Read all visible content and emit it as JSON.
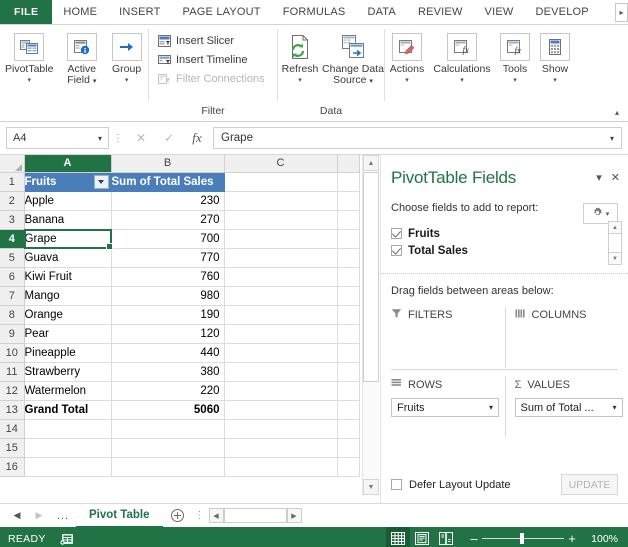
{
  "ribbon": {
    "tabs": [
      {
        "label": "FILE",
        "type": "file"
      },
      {
        "label": "HOME",
        "type": "normal"
      },
      {
        "label": "INSERT",
        "type": "normal"
      },
      {
        "label": "PAGE LAYOUT",
        "type": "normal"
      },
      {
        "label": "FORMULAS",
        "type": "normal"
      },
      {
        "label": "DATA",
        "type": "normal"
      },
      {
        "label": "REVIEW",
        "type": "normal"
      },
      {
        "label": "VIEW",
        "type": "normal"
      },
      {
        "label": "DEVELOP",
        "type": "clipped"
      }
    ],
    "scroll_right_icon": "chevron-right-icon",
    "collapse_icon": "chevron-up-icon",
    "groups": [
      {
        "label": "",
        "buttons": [
          {
            "label": "PivotTable",
            "icon": "pivot-table-icon",
            "dropdown": true
          },
          {
            "label": "Active\nField",
            "icon": "active-field-icon",
            "dropdown": true
          },
          {
            "label": "Group",
            "icon": "group-arrow-icon",
            "dropdown": true
          }
        ]
      },
      {
        "label": "Filter",
        "items": [
          {
            "label": "Insert Slicer",
            "icon": "slicer-icon",
            "disabled": false
          },
          {
            "label": "Insert Timeline",
            "icon": "timeline-icon",
            "disabled": false
          },
          {
            "label": "Filter Connections",
            "icon": "filter-connections-icon",
            "disabled": true
          }
        ]
      },
      {
        "label": "Data",
        "buttons": [
          {
            "label": "Refresh",
            "icon": "refresh-icon",
            "dropdown": true
          },
          {
            "label": "Change Data\nSource",
            "icon": "change-data-source-icon",
            "dropdown": true
          }
        ]
      },
      {
        "label": "",
        "buttons": [
          {
            "label": "Actions",
            "icon": "actions-icon",
            "dropdown": true
          },
          {
            "label": "Calculations",
            "icon": "calculations-icon",
            "dropdown": true
          },
          {
            "label": "Tools",
            "icon": "tools-icon",
            "dropdown": true
          },
          {
            "label": "Show",
            "icon": "show-icon",
            "dropdown": true
          }
        ]
      }
    ]
  },
  "formula_bar": {
    "name_box_value": "A4",
    "cancel_icon": "cancel-icon",
    "enter_icon": "check-icon",
    "function_icon": "fx-icon",
    "formula_value": "Grape",
    "expand_icon": "chevron-down-icon"
  },
  "sheet": {
    "columns": [
      "A",
      "B",
      "C"
    ],
    "active_column": "A",
    "active_row": 4,
    "rows": [
      {
        "n": 1,
        "a": "Fruits",
        "b": "Sum of Total Sales",
        "style": "header"
      },
      {
        "n": 2,
        "a": "Apple",
        "b": "230",
        "style": "data"
      },
      {
        "n": 3,
        "a": "Banana",
        "b": "270",
        "style": "data"
      },
      {
        "n": 4,
        "a": "Grape",
        "b": "700",
        "style": "data"
      },
      {
        "n": 5,
        "a": "Guava",
        "b": "770",
        "style": "data"
      },
      {
        "n": 6,
        "a": "Kiwi Fruit",
        "b": "760",
        "style": "data"
      },
      {
        "n": 7,
        "a": "Mango",
        "b": "980",
        "style": "data"
      },
      {
        "n": 8,
        "a": "Orange",
        "b": "190",
        "style": "data"
      },
      {
        "n": 9,
        "a": "Pear",
        "b": "120",
        "style": "data"
      },
      {
        "n": 10,
        "a": "Pineapple",
        "b": "440",
        "style": "data"
      },
      {
        "n": 11,
        "a": "Strawberry",
        "b": "380",
        "style": "data"
      },
      {
        "n": 12,
        "a": "Watermelon",
        "b": "220",
        "style": "data"
      },
      {
        "n": 13,
        "a": "Grand Total",
        "b": "5060",
        "style": "total"
      },
      {
        "n": 14,
        "a": "",
        "b": "",
        "style": "data"
      },
      {
        "n": 15,
        "a": "",
        "b": "",
        "style": "data"
      },
      {
        "n": 16,
        "a": "",
        "b": "",
        "style": "data"
      }
    ],
    "filter_button_icon": "filter-dropdown-icon",
    "scroll_up_icon": "triangle-up-icon",
    "scroll_down_icon": "triangle-down-icon"
  },
  "pane": {
    "title": "PivotTable Fields",
    "menu_icon": "chevron-down-icon",
    "close_icon": "close-icon",
    "choose_label": "Choose fields to add to report:",
    "gear_icon": "gear-icon",
    "gear_caret": "chevron-down-icon",
    "fields": [
      {
        "label": "Fruits",
        "checked": true
      },
      {
        "label": "Total Sales",
        "checked": true
      }
    ],
    "drag_label": "Drag fields between areas below:",
    "areas": [
      {
        "name": "FILTERS",
        "icon": "filter-funnel-icon",
        "pill": null
      },
      {
        "name": "COLUMNS",
        "icon": "columns-icon",
        "pill": null
      },
      {
        "name": "ROWS",
        "icon": "rows-icon",
        "pill": "Fruits"
      },
      {
        "name": "VALUES",
        "icon": "sigma-icon",
        "pill": "Sum of Total ..."
      }
    ],
    "pill_caret": "chevron-down-icon",
    "defer_label": "Defer Layout Update",
    "defer_checked": false,
    "update_label": "UPDATE"
  },
  "sheet_tabs": {
    "first_icon": "nav-first-icon",
    "prev_icon": "nav-prev-icon",
    "dots": "...",
    "tabs": [
      {
        "label": "Pivot Table",
        "active": true
      }
    ],
    "add_icon": "add-sheet-icon",
    "hscroll_left_icon": "triangle-left-icon",
    "hscroll_right_icon": "triangle-right-icon"
  },
  "status_bar": {
    "ready_label": "READY",
    "record_icon": "macro-record-icon",
    "views": [
      {
        "icon": "normal-view-icon",
        "active": true
      },
      {
        "icon": "page-layout-view-icon",
        "active": false
      },
      {
        "icon": "page-break-view-icon",
        "active": false
      }
    ],
    "zoom_out_label": "–",
    "zoom_in_label": "+",
    "zoom_level": "100%"
  },
  "colors": {
    "excel_green": "#217346",
    "pivot_header_blue": "#4a7ebb",
    "selection_green": "#217346"
  }
}
